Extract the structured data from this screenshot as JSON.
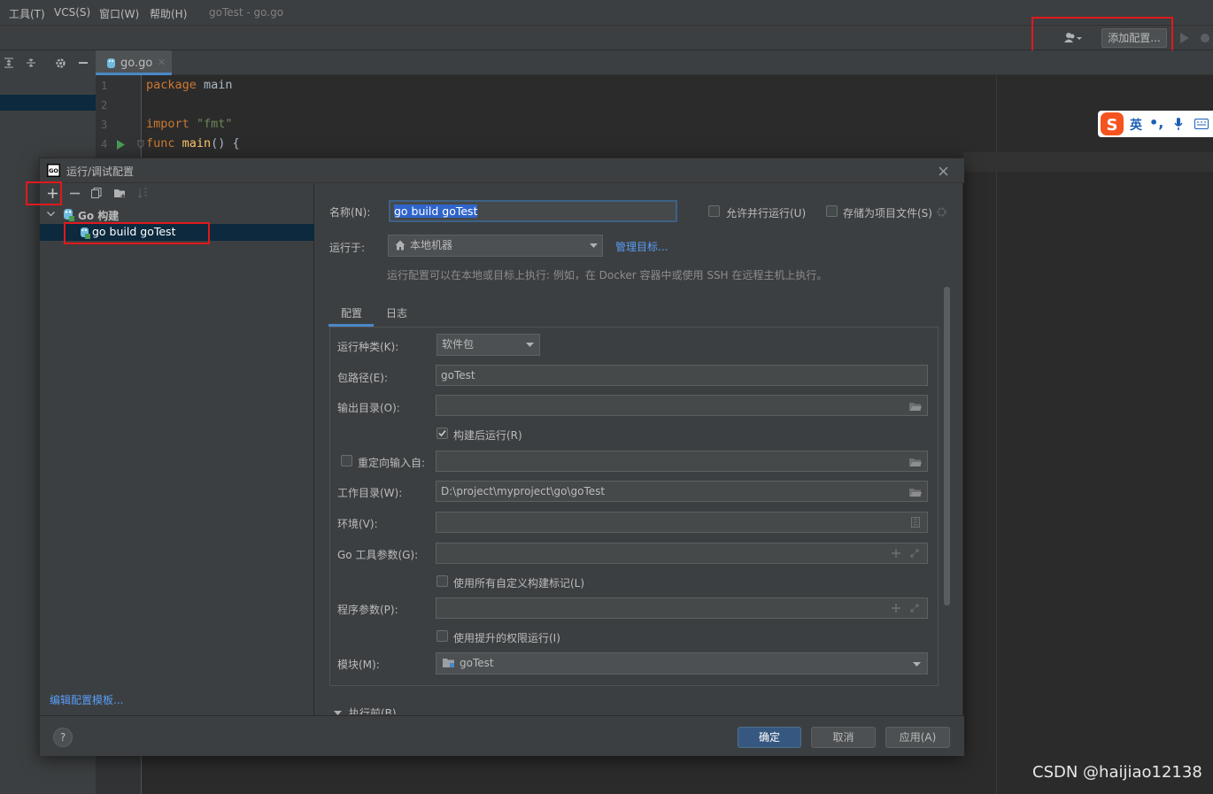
{
  "menubar": {
    "items": [
      "工具(T)",
      "VCS(S)",
      "窗口(W)",
      "帮助(H)"
    ],
    "window_title": "goTest - go.go"
  },
  "toolbar": {
    "add_config_label": "添加配置..."
  },
  "editor": {
    "tab_label": "go.go",
    "lines": [
      {
        "num": "1",
        "text": "package main"
      },
      {
        "num": "2",
        "text": ""
      },
      {
        "num": "3",
        "text": "import \"fmt\""
      },
      {
        "num": "4",
        "text": "func main() {"
      }
    ]
  },
  "sogou": {
    "lang_label": "英"
  },
  "dialog": {
    "title": "运行/调试配置",
    "tree": {
      "group_label": "Go 构建",
      "item_label": "go build goTest"
    },
    "edit_templates_link": "编辑配置模板...",
    "name_label": "名称(N):",
    "name_value": "go build goTest",
    "allow_parallel_label": "允许并行运行(U)",
    "store_as_project_label": "存储为项目文件(S)",
    "run_on_label": "运行于:",
    "run_on_value": "本地机器",
    "manage_targets_link": "管理目标...",
    "run_on_hint": "运行配置可以在本地或目标上执行: 例如，在 Docker 容器中或使用 SSH 在远程主机上执行。",
    "tabs": [
      "配置",
      "日志"
    ],
    "kind_label": "运行种类(K):",
    "kind_value": "软件包",
    "package_path_label": "包路径(E):",
    "package_path_value": "goTest",
    "output_dir_label": "输出目录(O):",
    "output_dir_value": "",
    "run_after_build_label": "构建后运行(R)",
    "run_after_build_checked": true,
    "redirect_input_label": "重定向输入自:",
    "redirect_input_value": "",
    "working_dir_label": "工作目录(W):",
    "working_dir_value": "D:\\project\\myproject\\go\\goTest",
    "env_label": "环境(V):",
    "env_value": "",
    "go_tool_args_label": "Go 工具参数(G):",
    "go_tool_args_value": "",
    "use_custom_tags_label": "使用所有自定义构建标记(L)",
    "program_args_label": "程序参数(P):",
    "program_args_value": "",
    "elevated_label": "使用提升的权限运行(I)",
    "module_label": "模块(M):",
    "module_value": "goTest",
    "before_launch_label": "执行前(B)",
    "ok_label": "确定",
    "cancel_label": "取消",
    "apply_label": "应用(A)",
    "help_label": "?"
  },
  "watermark": "CSDN @haijiao12138",
  "colors": {
    "accent": "#365880",
    "link": "#589df6",
    "highlight_box": "#e0191c",
    "selection": "#0d293e"
  }
}
